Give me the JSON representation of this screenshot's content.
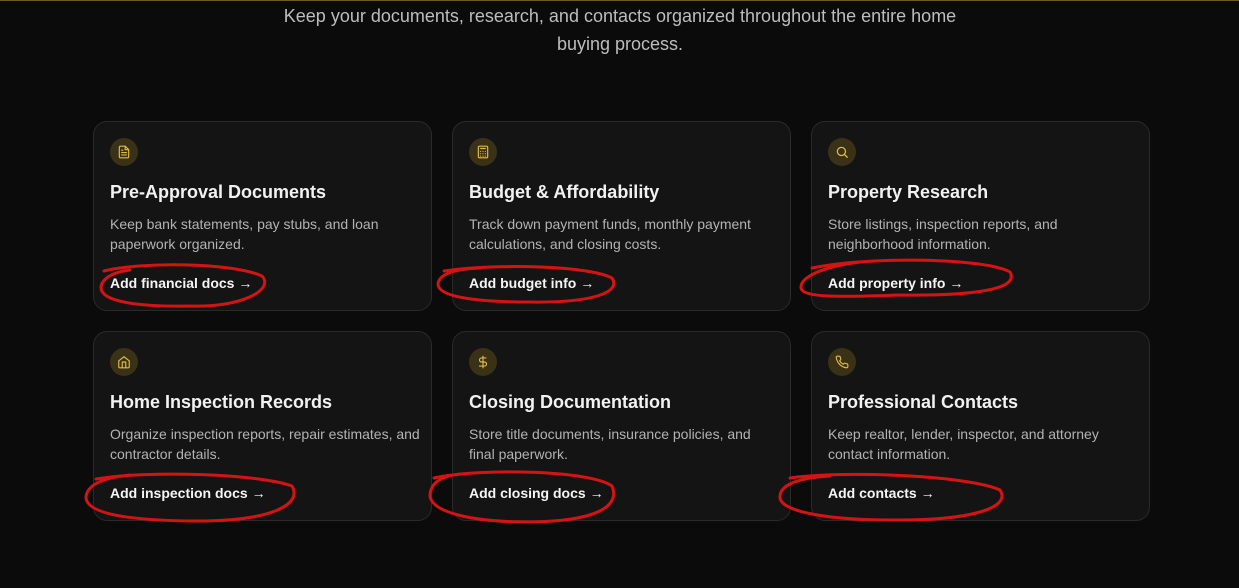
{
  "subtitle": "Keep your documents, research, and contacts organized throughout the entire home buying process.",
  "accent_color": "#e0b84a",
  "annotation_color": "#d41414",
  "cards": [
    {
      "icon": "document-icon",
      "title": "Pre-Approval Documents",
      "description": "Keep bank statements, pay stubs, and loan paperwork organized.",
      "link": "Add financial docs →"
    },
    {
      "icon": "calculator-icon",
      "title": "Budget & Affordability",
      "description": "Track down payment funds, monthly payment calculations, and closing costs.",
      "link": "Add budget info →"
    },
    {
      "icon": "search-icon",
      "title": "Property Research",
      "description": "Store listings, inspection reports, and neighborhood information.",
      "link": "Add property info →"
    },
    {
      "icon": "home-icon",
      "title": "Home Inspection Records",
      "description": "Organize inspection reports, repair estimates, and contractor details.",
      "link": "Add inspection docs →"
    },
    {
      "icon": "dollar-icon",
      "title": "Closing Documentation",
      "description": "Store title documents, insurance policies, and final paperwork.",
      "link": "Add closing docs →"
    },
    {
      "icon": "phone-icon",
      "title": "Professional Contacts",
      "description": "Keep realtor, lender, inspector, and attorney contact information.",
      "link": "Add contacts →"
    }
  ]
}
